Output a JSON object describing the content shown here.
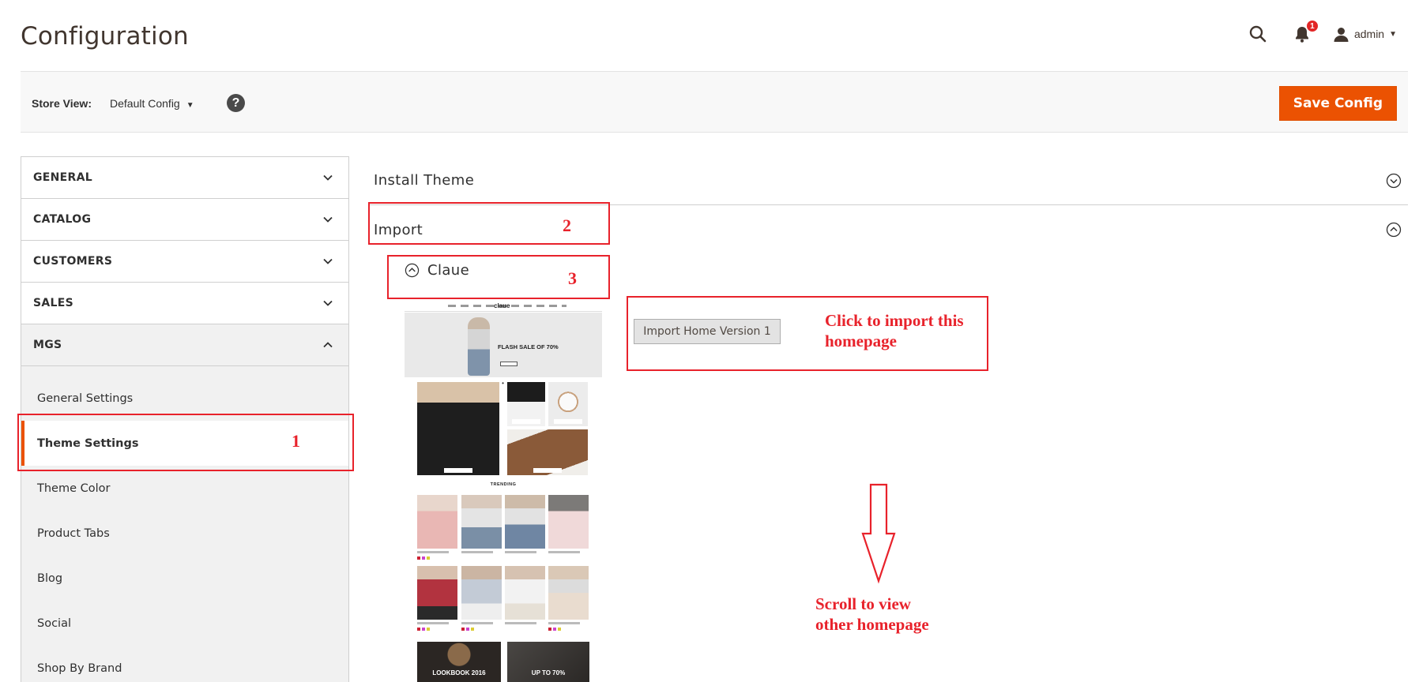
{
  "page": {
    "title": "Configuration"
  },
  "header": {
    "notification_count": "1",
    "user": "admin",
    "icons": [
      "search-icon",
      "bell-icon",
      "user-icon",
      "caret-down-icon"
    ]
  },
  "store_bar": {
    "label": "Store View:",
    "selected": "Default Config",
    "help_glyph": "?",
    "save_label": "Save Config"
  },
  "sidebar": {
    "sections": [
      {
        "label": "GENERAL",
        "open": false
      },
      {
        "label": "CATALOG",
        "open": false
      },
      {
        "label": "CUSTOMERS",
        "open": false
      },
      {
        "label": "SALES",
        "open": false
      },
      {
        "label": "MGS",
        "open": true
      }
    ],
    "items": [
      {
        "label": "General Settings",
        "active": false
      },
      {
        "label": "Theme Settings",
        "active": true
      },
      {
        "label": "Theme Color",
        "active": false
      },
      {
        "label": "Product Tabs",
        "active": false
      },
      {
        "label": "Blog",
        "active": false
      },
      {
        "label": "Social",
        "active": false
      },
      {
        "label": "Shop By Brand",
        "active": false
      }
    ]
  },
  "main": {
    "groups": [
      {
        "label": "Install Theme",
        "expanded": false
      },
      {
        "label": "Import",
        "expanded": true
      }
    ],
    "subgroup": {
      "label": "Claue",
      "expanded": true
    },
    "preview": {
      "logo": "claue",
      "hero_text": "FLASH SALE OF 70%",
      "dots": "• • •",
      "trending": "TRENDING",
      "banners": [
        "LOOKBOOK 2016",
        "UP TO 70%"
      ]
    },
    "import_button": "Import Home Version 1"
  },
  "annotations": {
    "numbers": [
      "1",
      "2",
      "3"
    ],
    "click_note": "Click to import this\nhomepage",
    "scroll_note": "Scroll to view\nother homepage"
  },
  "colors": {
    "accent": "#eb5202",
    "annotation": "#e8222b",
    "sidebar_bg": "#f1f1f1"
  }
}
